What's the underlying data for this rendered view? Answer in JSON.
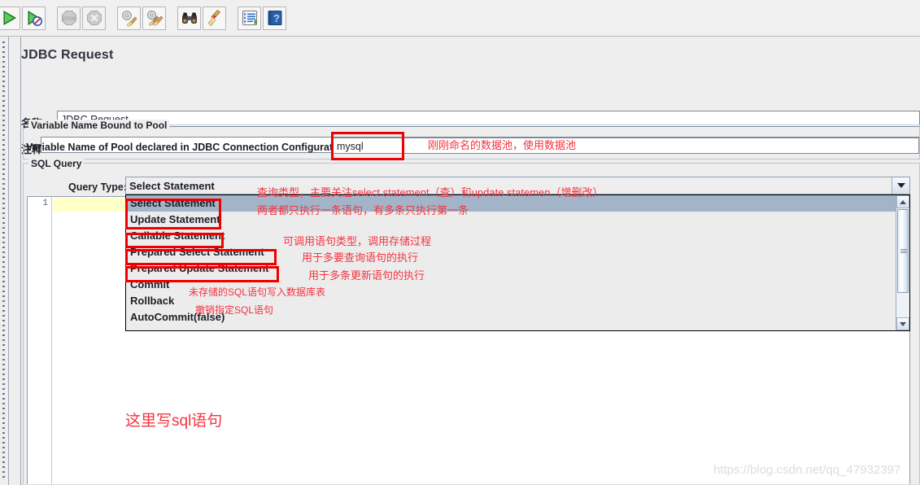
{
  "toolbar": {
    "buttons": [
      {
        "name": "start-button",
        "icon": "green-play-icon",
        "enabled": true
      },
      {
        "name": "start-no-timers-button",
        "icon": "green-play-no-timers-icon",
        "enabled": true
      },
      {
        "name": "stop-button",
        "icon": "stop-sign-icon",
        "enabled": false
      },
      {
        "name": "shutdown-button",
        "icon": "shutdown-x-icon",
        "enabled": false
      },
      {
        "name": "clear-button",
        "icon": "gear-broom-icon",
        "enabled": true
      },
      {
        "name": "clear-all-button",
        "icon": "gear-double-broom-icon",
        "enabled": true
      },
      {
        "name": "search-button",
        "icon": "binoculars-icon",
        "enabled": true
      },
      {
        "name": "reset-search-button",
        "icon": "broom-icon",
        "enabled": true
      },
      {
        "name": "function-helper-button",
        "icon": "list-notes-icon",
        "enabled": true
      },
      {
        "name": "help-button",
        "icon": "blue-book-question-icon",
        "enabled": true
      }
    ]
  },
  "page": {
    "title": "JDBC Request"
  },
  "fields": {
    "name_label": "名称：",
    "name_value": "JDBC Request",
    "comment_label": "注释：",
    "comment_value": ""
  },
  "pool_group": {
    "title": "Variable Name Bound to Pool",
    "label": "Variable Name of Pool declared in JDBC Connection Configuration:",
    "value": "mysql"
  },
  "sql_group": {
    "title": "SQL Query",
    "query_type_label": "Query Type:",
    "query_type_value": "Select Statement"
  },
  "dropdown": {
    "items": [
      {
        "label": "Select Statement",
        "selected": true
      },
      {
        "label": "Update Statement",
        "selected": false
      },
      {
        "label": "Callable Statement",
        "selected": false
      },
      {
        "label": "Prepared Select Statement",
        "selected": false
      },
      {
        "label": "Prepared Update Statement",
        "selected": false
      },
      {
        "label": "Commit",
        "selected": false
      },
      {
        "label": "Rollback",
        "selected": false
      },
      {
        "label": "AutoCommit(false)",
        "selected": false
      }
    ]
  },
  "editor": {
    "line_number": "1",
    "content": ""
  },
  "annotations": {
    "pool": "刚刚命名的数据池，使用数据池",
    "query_type_1": "查询类型，主要关注select statement（查）和update statemen（增删改）",
    "query_type_2": "两者都只执行一条语句，有多条只执行第一条",
    "callable": "可调用语句类型，调用存储过程",
    "prepared_select": "用于多要查询语句的执行",
    "prepared_update": "用于多条更新语句的执行",
    "commit": "未存储的SQL语句写入数据库表",
    "rollback": "撤销指定SQL语句",
    "sql_area": "这里写sql语句"
  },
  "watermark": "https://blog.csdn.net/qq_47932397",
  "colors": {
    "annotation_red": "#f5333f",
    "redbox_border": "#ef0000",
    "panel_bg": "#eeeeee",
    "selection_blue": "#a3b4c8",
    "current_line_yellow": "#ffffc8"
  }
}
